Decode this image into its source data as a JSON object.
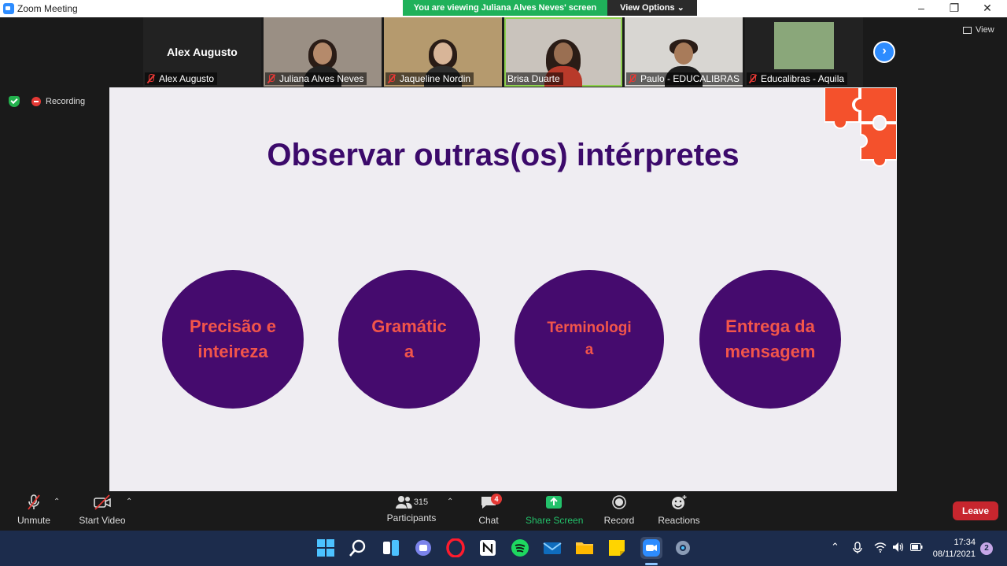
{
  "window": {
    "title": "Zoom Meeting"
  },
  "banner": {
    "text": "You are viewing Juliana Alves Neves' screen",
    "view_options": "View Options"
  },
  "participants_strip": [
    {
      "name": "Alex Augusto",
      "video": false,
      "header": "Alex Augusto"
    },
    {
      "name": "Juliana Alves Neves",
      "video": true
    },
    {
      "name": "Jaqueline Nordin",
      "video": true
    },
    {
      "name": "Brisa Duarte",
      "video": true,
      "active_speaker": true
    },
    {
      "name": "Paulo - EDUCALIBRAS",
      "video": true
    },
    {
      "name": "Educalibras - Aquila",
      "video": true
    }
  ],
  "view_button": "View",
  "status": {
    "recording": "Recording"
  },
  "slide": {
    "title": "Observar outras(os) intérpretes",
    "circles": [
      {
        "line1": "Precisão e",
        "line2": "inteireza"
      },
      {
        "line1": "Gramátic",
        "line2": "a"
      },
      {
        "line1": "Terminologi",
        "line2": "a"
      },
      {
        "line1": "Entrega da",
        "line2": "mensagem"
      }
    ],
    "colors": {
      "circle": "#450b6e",
      "circle_text": "#f2554a",
      "title": "#3c0a6b",
      "puzzle": "#f4512c"
    }
  },
  "toolbar": {
    "unmute": "Unmute",
    "start_video": "Start Video",
    "participants_count": "315",
    "participants": "Participants",
    "chat": "Chat",
    "chat_badge": "4",
    "share_screen": "Share Screen",
    "record": "Record",
    "reactions": "Reactions",
    "leave": "Leave"
  },
  "taskbar": {
    "time": "17:34",
    "date": "08/11/2021",
    "notifications": "2",
    "apps": [
      "windows-start-icon",
      "search-icon",
      "task-view-icon",
      "teams-chat-icon",
      "opera-icon",
      "notion-icon",
      "spotify-icon",
      "mail-icon",
      "file-explorer-icon",
      "sticky-notes-icon",
      "zoom-icon",
      "settings-icon"
    ]
  }
}
